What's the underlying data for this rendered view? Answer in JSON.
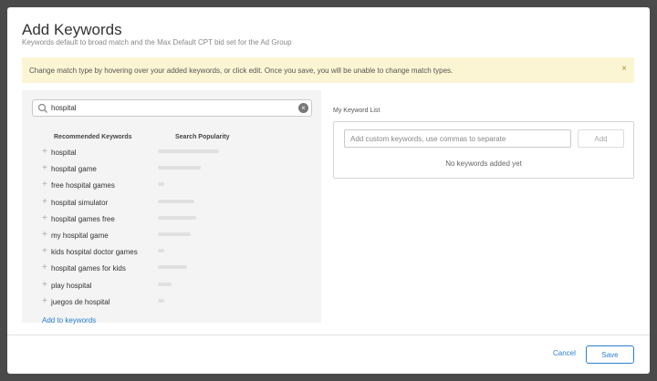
{
  "modal": {
    "title": "Add Keywords",
    "subtitle": "Keywords default to broad match and the Max Default CPT bid set for the Ad Group"
  },
  "alert": {
    "text": "Change match type by hovering over your added keywords, or click edit. Once you save, you will be unable to change match types.",
    "close_label": "×"
  },
  "search": {
    "value": "hospital",
    "clear_label": "×"
  },
  "recommended": {
    "col_keywords": "Recommended Keywords",
    "col_popularity": "Search Popularity",
    "items": [
      {
        "label": "hospital",
        "popularity": 0.95
      },
      {
        "label": "hospital game",
        "popularity": 0.67
      },
      {
        "label": "free hospital games",
        "popularity": 0.1
      },
      {
        "label": "hospital simulator",
        "popularity": 0.57
      },
      {
        "label": "hospital games free",
        "popularity": 0.6
      },
      {
        "label": "my hospital game",
        "popularity": 0.52
      },
      {
        "label": "kids hospital doctor games",
        "popularity": 0.1
      },
      {
        "label": "hospital games for kids",
        "popularity": 0.45
      },
      {
        "label": "play hospital",
        "popularity": 0.22
      },
      {
        "label": "juegos de hospital",
        "popularity": 0.1
      }
    ],
    "add_link": "Add to keywords"
  },
  "my_list": {
    "label": "My Keyword List",
    "placeholder": "Add custom keywords, use commas to separate",
    "add_button": "Add",
    "empty_text": "No keywords added yet"
  },
  "footer": {
    "cancel": "Cancel",
    "save": "Save"
  },
  "colors": {
    "accent": "#2b7fd1",
    "alert_bg": "#fbf5d3",
    "panel_bg": "#f4f4f4"
  }
}
